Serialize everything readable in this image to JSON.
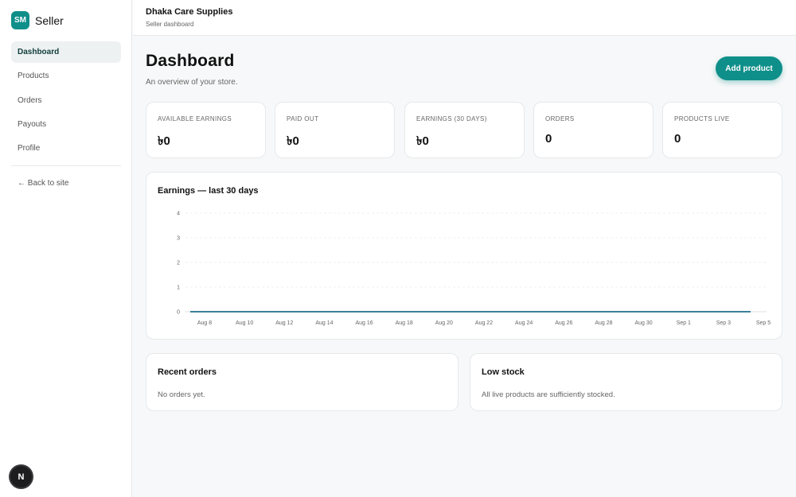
{
  "sidebar": {
    "badge": "SM",
    "title": "Seller",
    "items": [
      {
        "label": "Dashboard",
        "active": true
      },
      {
        "label": "Products",
        "active": false
      },
      {
        "label": "Orders",
        "active": false
      },
      {
        "label": "Payouts",
        "active": false
      },
      {
        "label": "Profile",
        "active": false
      }
    ],
    "back_link": "← Back to site",
    "n_badge": "N"
  },
  "header": {
    "store_name": "Dhaka Care Supplies",
    "subtitle": "Seller dashboard"
  },
  "main": {
    "title": "Dashboard",
    "subtitle": "An overview of your store.",
    "add_button": "Add product",
    "stats": [
      {
        "label": "AVAILABLE EARNINGS",
        "value": "৳0"
      },
      {
        "label": "PAID OUT",
        "value": "৳0"
      },
      {
        "label": "EARNINGS (30 DAYS)",
        "value": "৳0"
      },
      {
        "label": "ORDERS",
        "value": "0"
      },
      {
        "label": "PRODUCTS LIVE",
        "value": "0"
      }
    ],
    "chart_title": "Earnings — last 30 days",
    "recent_orders": {
      "title": "Recent orders",
      "text": "No orders yet."
    },
    "low_stock": {
      "title": "Low stock",
      "text": "All live products are sufficiently stocked."
    }
  },
  "colors": {
    "accent": "#0f8f8a",
    "line": "#1f6f8b"
  },
  "chart_data": {
    "type": "line",
    "title": "Earnings — last 30 days",
    "xlabel": "",
    "ylabel": "",
    "x": [
      "Aug 8",
      "Aug 10",
      "Aug 12",
      "Aug 14",
      "Aug 16",
      "Aug 18",
      "Aug 20",
      "Aug 22",
      "Aug 24",
      "Aug 26",
      "Aug 28",
      "Aug 30",
      "Sep 1",
      "Sep 3",
      "Sep 5"
    ],
    "series": [
      {
        "values": [
          0,
          0,
          0,
          0,
          0,
          0,
          0,
          0,
          0,
          0,
          0,
          0,
          0,
          0,
          0
        ]
      }
    ],
    "yticks": [
      0,
      1,
      2,
      3,
      4
    ],
    "ylim": [
      0,
      4
    ],
    "grid": true
  }
}
